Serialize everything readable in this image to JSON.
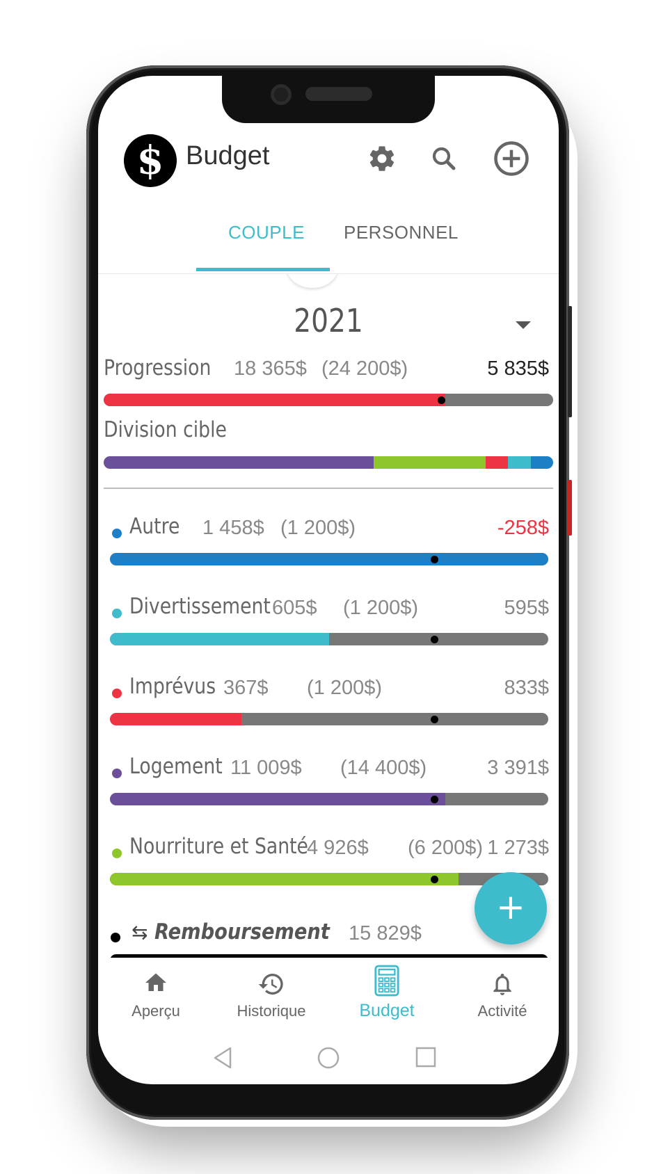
{
  "app": {
    "title": "Budget",
    "logo_glyph": "$"
  },
  "header_icons": [
    "gear-icon",
    "search-icon",
    "add-circle-icon"
  ],
  "tabs": [
    {
      "label": "COUPLE",
      "active": true
    },
    {
      "label": "PERSONNEL",
      "active": false
    }
  ],
  "year": "2021",
  "progression": {
    "label": "Progression",
    "spent": "18 365$",
    "target": "(24 200$)",
    "remaining": "5 835$",
    "fraction": 0.76,
    "marker": 0.75,
    "color": "#ee3344"
  },
  "division": {
    "label": "Division cible",
    "segments": [
      {
        "color": "#6c4f9b",
        "fraction": 0.6
      },
      {
        "color": "#8dc72b",
        "fraction": 0.25
      },
      {
        "color": "#ee3344",
        "fraction": 0.05
      },
      {
        "color": "#3fbccc",
        "fraction": 0.05
      },
      {
        "color": "#1d7fc6",
        "fraction": 0.05
      }
    ]
  },
  "categories": [
    {
      "name": "Autre",
      "spent": "1 458$",
      "target": "(1 200$)",
      "remaining": "-258$",
      "color": "#1d7fc6",
      "fraction": 1.0,
      "marker": 0.74,
      "over": true
    },
    {
      "name": "Divertissement",
      "spent": "605$",
      "target": "(1 200$)",
      "remaining": "595$",
      "color": "#3fbccc",
      "fraction": 0.5,
      "marker": 0.74,
      "over": false
    },
    {
      "name": "Imprévus",
      "spent": "367$",
      "target": "(1 200$)",
      "remaining": "833$",
      "color": "#ee3344",
      "fraction": 0.3,
      "marker": 0.74,
      "over": false
    },
    {
      "name": "Logement",
      "spent": "11 009$",
      "target": "(14 400$)",
      "remaining": "3 391$",
      "color": "#6c4f9b",
      "fraction": 0.765,
      "marker": 0.74,
      "over": false
    },
    {
      "name": "Nourriture et Santé",
      "spent": "4 926$",
      "target": "(6 200$)",
      "remaining": "1 273$",
      "color": "#8dc72b",
      "fraction": 0.795,
      "marker": 0.74,
      "over": false
    }
  ],
  "reimbursement": {
    "name": "Remboursement",
    "amount": "15 829$",
    "icon": "swap-arrows-icon",
    "color": "#000000"
  },
  "fab": {
    "label": "+"
  },
  "bottom_nav": [
    {
      "label": "Aperçu",
      "icon": "home-icon",
      "active": false
    },
    {
      "label": "Historique",
      "icon": "history-icon",
      "active": false
    },
    {
      "label": "Budget",
      "icon": "calculator-icon",
      "active": true
    },
    {
      "label": "Activité",
      "icon": "bell-icon",
      "active": false
    }
  ],
  "system_nav": [
    "back-icon",
    "home-circle-icon",
    "recents-icon"
  ],
  "colors": {
    "accent": "#3fbccc",
    "negative": "#ee3344"
  }
}
